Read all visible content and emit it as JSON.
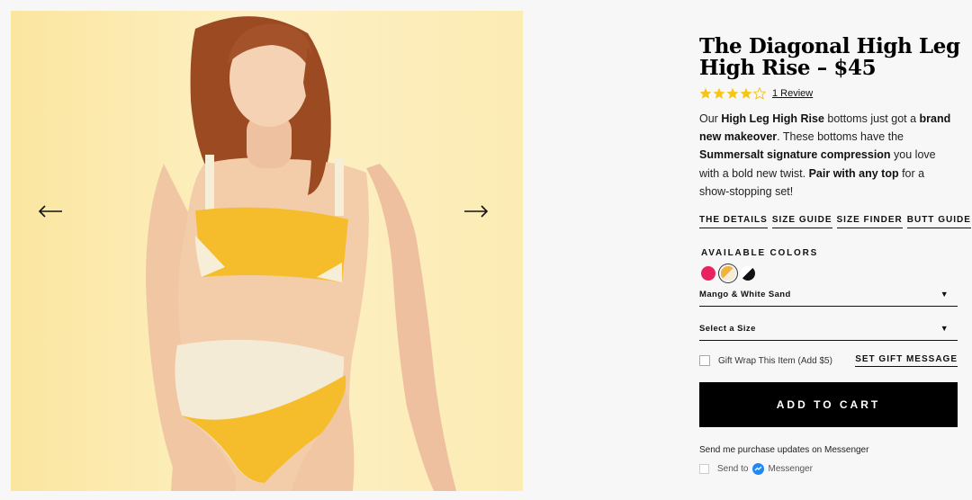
{
  "product": {
    "title": "The Diagonal High Leg High Rise – $45",
    "rating": 4,
    "rating_max": 5,
    "review_link": "1 Review",
    "description_parts": {
      "p1": "Our ",
      "b1": "High Leg High Rise",
      "p2": " bottoms just got a ",
      "b2": "brand new makeover",
      "p3": ". These bottoms have the ",
      "b3": "Summersalt signature compression",
      "p4": " you love with a bold new twist. ",
      "b4": "Pair with any top",
      "p5": " for a show-stopping set!"
    }
  },
  "links": {
    "details": "THE DETAILS",
    "size_guide": "SIZE GUIDE",
    "size_finder": "SIZE FINDER",
    "butt_guide": "BUTT GUIDE"
  },
  "colors": {
    "label": "AVAILABLE COLORS",
    "swatches": [
      {
        "name": "pink-swatch",
        "color": "#e8235f"
      },
      {
        "name": "mango-white-sand-swatch",
        "color": "#f3b23a"
      },
      {
        "name": "black-white-swatch",
        "color": "#111111"
      }
    ],
    "selected": "Mango & White Sand"
  },
  "size": {
    "placeholder": "Select a Size"
  },
  "gift": {
    "label": "Gift Wrap This Item (Add $5)",
    "message_link": "SET GIFT MESSAGE"
  },
  "cart": {
    "label": "ADD TO CART"
  },
  "messenger": {
    "prompt": "Send me purchase updates on Messenger",
    "send_to": "Send to",
    "brand": "Messenger"
  },
  "icons": {
    "prev": "arrow-left-icon",
    "next": "arrow-right-icon",
    "caret": "caret-down-icon",
    "messenger": "messenger-icon"
  },
  "colors_ui": {
    "accent": "#000000",
    "star": "#f5c518",
    "background": "#f7f7f7",
    "photo_bg": "#fbe9a8"
  }
}
